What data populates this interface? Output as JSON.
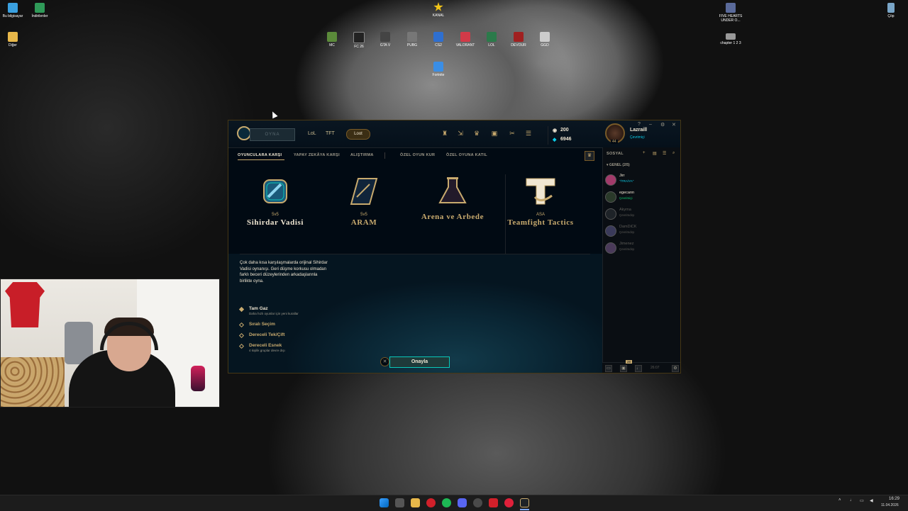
{
  "desktop": {
    "icons_left": [
      {
        "label": "Bu bilgisayar",
        "color": "#3aa0e0"
      },
      {
        "label": "İndirilenler",
        "color": "#2f9a58"
      },
      {
        "label": "Diğer",
        "color": "#e8b84a"
      }
    ],
    "icons_top": [
      {
        "label": "KANAL",
        "color": "#f2c418"
      },
      {
        "label": "MC",
        "color": "#5b8a3a"
      },
      {
        "label": "FC 26",
        "color": "#222222"
      },
      {
        "label": "GTA V",
        "color": "#444444"
      },
      {
        "label": "PUBG",
        "color": "#777777"
      },
      {
        "label": "CS2",
        "color": "#2e6fd0"
      },
      {
        "label": "VALORANT",
        "color": "#d23a48"
      },
      {
        "label": "LOL",
        "color": "#2b7a4a"
      },
      {
        "label": "DEVOUR",
        "color": "#a02020"
      },
      {
        "label": "GGD",
        "color": "#cccccc"
      },
      {
        "label": "Fortnite",
        "color": "#3a8ee6"
      }
    ],
    "icons_right": [
      {
        "label": "FIVE HEARTS UNDER O...",
        "color": "#5a6a9a"
      },
      {
        "label": "chapter 1 2 3",
        "color": "#999999"
      },
      {
        "label": "Çöp",
        "color": "#7aa6c8"
      }
    ]
  },
  "client": {
    "play_label": "OYNA",
    "nav": [
      "LoL",
      "TFT"
    ],
    "loot_label": "Loot",
    "currency": {
      "rp": "200",
      "be": "6946"
    },
    "profile": {
      "name": "Lazraill",
      "status": "Çevrimiçi",
      "level": "44"
    },
    "window_controls": [
      "?",
      "–",
      "⚙",
      "✕"
    ],
    "subtabs": [
      {
        "label": "OYUNCULARA KARŞI",
        "active": true
      },
      {
        "label": "YAPAY ZEKÂYA KARŞI",
        "active": false
      },
      {
        "label": "ALIŞTIRMA",
        "active": false
      },
      {
        "label": "ÖZEL OYUN KUR",
        "active": false
      },
      {
        "label": "ÖZEL OYUNA KATIL",
        "active": false
      }
    ],
    "modes": [
      {
        "sub": "5v5",
        "name": "Sihirdar Vadisi",
        "selected": true
      },
      {
        "sub": "5v5",
        "name": "ARAM",
        "selected": false
      },
      {
        "sub": "",
        "name": "Arena ve Arbede",
        "selected": false
      },
      {
        "sub": "ASA",
        "name": "Teamfight Tactics",
        "selected": false
      }
    ],
    "description": "Çok daha kısa karşılaşmalarda orijinal Sihirdar Vadisi oynanışı. Geri düşme korkusu olmadan farklı beceri düzeylerinden arkadaşlarınla birlikte oyna.",
    "options": [
      {
        "label": "Tam Gaz",
        "hint": "Daha hızlı oyunlar için yeni kurallar",
        "selected": true
      },
      {
        "label": "Sıralı Seçim",
        "hint": "",
        "selected": false
      },
      {
        "label": "Dereceli Tek/Çift",
        "hint": "",
        "selected": false
      },
      {
        "label": "Dereceli Esnek",
        "hint": "4 kişilik gruplar devre dışı",
        "selected": false
      }
    ],
    "confirm_label": "Onayla",
    "social": {
      "title": "SOSYAL",
      "group": "GENEL (2/5)",
      "friends": [
        {
          "name": "Jirr",
          "status": "\"İTRAİYA\"",
          "online": true,
          "status_color": "#0acbe6"
        },
        {
          "name": "egecann",
          "status": "Çevrimiçi",
          "online": true,
          "status_color": "#0acb6e"
        },
        {
          "name": "Akyma",
          "status": "Çevrimdışı",
          "online": false,
          "status_color": "#5b5a56"
        },
        {
          "name": "DamDiCK",
          "status": "Çevrimdışı",
          "online": false,
          "status_color": "#5b5a56"
        },
        {
          "name": "Jimenez",
          "status": "Çevrimdışı",
          "online": false,
          "status_color": "#5b5a56"
        }
      ],
      "bottom_badge": "28",
      "time": "26:07"
    }
  },
  "taskbar": {
    "time": "16:29",
    "date": "11.04.2026"
  }
}
